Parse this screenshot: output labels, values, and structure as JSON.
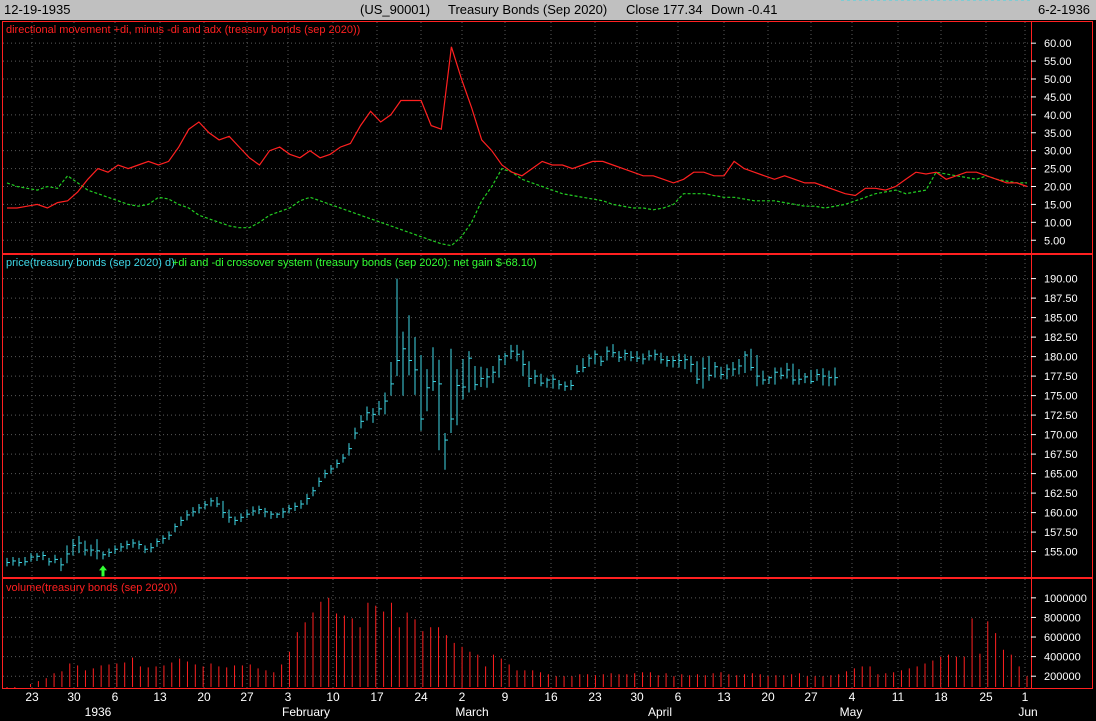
{
  "header": {
    "start_date": "12-19-1935",
    "symbol": "(US_90001)",
    "name": "Treasury Bonds (Sep 2020)",
    "close": "Close 177.34",
    "change": "Down -0.41",
    "end_date": "6-2-1936"
  },
  "colors": {
    "pos_di": "#ff2020",
    "neg_di": "#22cc22",
    "price": "#3fd7e6",
    "volume": "#ff2020",
    "up_arrow": "#33ff33",
    "down_arrow": "#ff2020",
    "grid": "#5a5a5a",
    "axis": "#ffffff",
    "border": "#ff2020"
  },
  "chart_data": [
    {
      "type": "line",
      "title": "directional movement +di, minus -di and adx (treasury bonds (sep 2020))",
      "ylim": [
        2,
        62
      ],
      "yticks": [
        "60.00",
        "55.00",
        "50.00",
        "45.00",
        "40.00",
        "35.00",
        "30.00",
        "25.00",
        "20.00",
        "15.00",
        "10.00",
        "5.00"
      ],
      "series": [
        {
          "name": "+di",
          "values": [
            14,
            14,
            14.5,
            15,
            14,
            15.5,
            16,
            18.5,
            22,
            25,
            24,
            26,
            25,
            26,
            27,
            26,
            27,
            31,
            36,
            38,
            35,
            33,
            34,
            31,
            28,
            26,
            30,
            31,
            29,
            28,
            30,
            28,
            29,
            31,
            32,
            37,
            41,
            38,
            40,
            44,
            44,
            44,
            37,
            36,
            59,
            50,
            42,
            33,
            30,
            26,
            24,
            23,
            25,
            27,
            26,
            26,
            25,
            26,
            27,
            27,
            26,
            25,
            24,
            23,
            23,
            22,
            21,
            22,
            24,
            24,
            23,
            23,
            27,
            25,
            24,
            23,
            22,
            23,
            22,
            21,
            21,
            20,
            19,
            18,
            17.5,
            19.5,
            19.5,
            19,
            20,
            22,
            24,
            23.5,
            24,
            22,
            23,
            24,
            24,
            23,
            22,
            21,
            21,
            20
          ]
        },
        {
          "name": "-di",
          "values": [
            21,
            20,
            19.5,
            19,
            20,
            19.5,
            23,
            21,
            19,
            18,
            17,
            16,
            15,
            14.5,
            15,
            17,
            16.5,
            15,
            14,
            12,
            11,
            10,
            9,
            8.5,
            8.5,
            10,
            12,
            13,
            14,
            16,
            17,
            16,
            15,
            14,
            13,
            12,
            11,
            10,
            9,
            8,
            7,
            6,
            5,
            4,
            3.5,
            6,
            10,
            16,
            20,
            25,
            24,
            22,
            21,
            20,
            19,
            18,
            17.5,
            17,
            16.5,
            16,
            15,
            14.5,
            14,
            14,
            13.5,
            14,
            15,
            18,
            18,
            18,
            17.5,
            17,
            17,
            16.5,
            16,
            16,
            16,
            15.5,
            15,
            14.5,
            14.5,
            14,
            14.5,
            15,
            16,
            17,
            18,
            18.5,
            19,
            18,
            18.5,
            19,
            24,
            23.5,
            23,
            22.5,
            22,
            23,
            22,
            21.5,
            21,
            21
          ]
        }
      ]
    },
    {
      "type": "bar",
      "title": "price(treasury bonds (sep 2020) d)",
      "subtitle": "+di and -di crossover system (treasury bonds (sep 2020): net gain $-68.10)",
      "ylim": [
        152,
        192
      ],
      "yticks": [
        "190.00",
        "187.50",
        "185.00",
        "182.50",
        "180.00",
        "177.50",
        "175.00",
        "172.50",
        "170.00",
        "167.50",
        "165.00",
        "162.50",
        "160.00",
        "157.50",
        "155.00"
      ],
      "x": [
        7,
        13,
        19,
        25,
        31,
        37,
        43,
        49,
        55,
        61,
        67,
        73,
        79,
        85,
        91,
        97,
        103,
        109,
        115,
        121,
        127,
        133,
        139,
        145,
        151,
        157,
        163,
        169,
        175,
        181,
        187,
        193,
        199,
        205,
        211,
        217,
        223,
        229,
        235,
        241,
        247,
        253,
        259,
        265,
        271,
        277,
        283,
        289,
        295,
        301,
        307,
        313,
        319,
        325,
        331,
        337,
        343,
        349,
        355,
        361,
        367,
        373,
        379,
        385,
        391,
        397,
        403,
        409,
        415,
        421,
        427,
        433,
        439,
        445,
        451,
        457,
        463,
        469,
        475,
        481,
        487,
        493,
        499,
        505,
        511,
        517,
        523,
        529,
        535,
        541,
        547,
        553,
        559,
        565,
        571,
        577,
        583,
        589,
        595,
        601,
        607,
        613,
        619,
        625,
        631,
        637,
        643,
        649,
        655,
        661,
        667,
        673,
        679,
        685,
        691,
        697,
        703,
        709,
        715,
        721,
        727,
        733,
        739,
        745,
        751,
        757,
        763,
        769,
        775,
        781,
        787,
        793,
        799,
        805,
        811,
        817,
        823,
        829,
        835,
        841,
        847,
        853,
        859,
        865,
        871,
        877,
        883,
        889,
        895,
        901,
        907,
        913,
        919,
        925,
        931,
        937,
        943,
        949,
        955,
        961,
        967,
        973,
        979,
        985,
        991,
        997,
        1003,
        1009,
        1015,
        1021,
        1027
      ],
      "high": [
        154.2,
        154.3,
        154.2,
        154.3,
        154.8,
        154.8,
        155,
        154.2,
        154.6,
        154.2,
        155.8,
        156.6,
        157,
        156.4,
        155.9,
        156.6,
        155,
        155.4,
        155.8,
        156.1,
        156.4,
        156.6,
        156.4,
        155.8,
        156.1,
        156.7,
        157.1,
        157.6,
        158.6,
        159.5,
        160.3,
        160.7,
        161.1,
        161.5,
        161.9,
        162,
        161.5,
        160.4,
        159.5,
        159.9,
        160.4,
        160.8,
        160.9,
        160.6,
        160.2,
        160,
        160.6,
        161,
        161.3,
        161.6,
        162.4,
        163.3,
        164.5,
        165.5,
        166.1,
        166.8,
        167.5,
        168.9,
        170.9,
        172.5,
        173.6,
        173.4,
        174.3,
        175.4,
        179.3,
        190,
        183.2,
        185.3,
        182.5,
        180.2,
        178.4,
        181.2,
        179.6,
        170.2,
        181,
        178.4,
        179.7,
        180.7,
        178.8,
        178.7,
        178.5,
        178.8,
        180.2,
        180.5,
        181.5,
        181.5,
        180.8,
        179.4,
        178.3,
        177.8,
        177.3,
        177.7,
        177,
        176.8,
        177,
        178.9,
        179.8,
        180.3,
        180.8,
        180.1,
        181.3,
        181.6,
        180.7,
        180.9,
        180.7,
        180.7,
        180.4,
        180.8,
        180.9,
        180.5,
        180.1,
        180.1,
        180.4,
        180.3,
        180.1,
        179.4,
        179.9,
        180.1,
        179.3,
        178.7,
        179,
        179.3,
        179.7,
        180.7,
        181,
        180.2,
        178.2,
        177.5,
        178.6,
        178.6,
        179.2,
        179.1,
        178.4,
        177.9,
        178.3,
        178.4,
        178.5,
        178.2,
        178.6
      ],
      "low": [
        153.1,
        153.2,
        153.1,
        153.2,
        153.7,
        153.8,
        153.9,
        153.2,
        153.5,
        152.5,
        153.5,
        154.5,
        154.8,
        154.5,
        154.4,
        154,
        154,
        154.3,
        154.7,
        155,
        155.3,
        155.5,
        155.3,
        154.8,
        154.9,
        155.6,
        156,
        156.5,
        157.5,
        158.3,
        159,
        159.5,
        159.9,
        160.4,
        160.8,
        160.7,
        159.3,
        158.7,
        158.4,
        158.8,
        159.3,
        159.6,
        159.8,
        159.4,
        159.2,
        159.3,
        159.3,
        159.9,
        160.2,
        160.5,
        161,
        162.1,
        163.3,
        164.4,
        165,
        165.7,
        166.4,
        167.3,
        169.4,
        170.8,
        171.8,
        171.5,
        172.5,
        172.6,
        175,
        177.5,
        175,
        177.6,
        175.1,
        170.5,
        173,
        175.6,
        168,
        165.5,
        170.2,
        171.2,
        174.5,
        175.4,
        175.7,
        176.1,
        176,
        176.6,
        177.3,
        178.9,
        179.7,
        179.4,
        177.5,
        176.1,
        176.5,
        176.2,
        176,
        175.9,
        175.8,
        175.6,
        175.7,
        177.8,
        178,
        178.7,
        179,
        178.8,
        179.5,
        179.9,
        179.3,
        179.5,
        179.4,
        179.3,
        179,
        179.5,
        179.5,
        179.1,
        178.7,
        178.6,
        178.6,
        178.4,
        178,
        176.5,
        175.9,
        176.9,
        177.3,
        177.1,
        177.1,
        177.5,
        177.7,
        177.9,
        178.2,
        176.2,
        176.4,
        176.5,
        176.4,
        177.1,
        177.2,
        176.4,
        176.4,
        176.6,
        176.5,
        176.9,
        176.3,
        176.2,
        176.3
      ],
      "close": [
        153.6,
        153.8,
        153.6,
        153.7,
        154.3,
        154.4,
        154.5,
        153.7,
        154,
        153.3,
        154.7,
        155.8,
        156.1,
        155.2,
        155.2,
        155.1,
        154.6,
        154.9,
        155.3,
        155.6,
        155.9,
        156.1,
        155.9,
        155.3,
        155.5,
        156.3,
        156.7,
        157.1,
        158.2,
        159,
        159.7,
        160.1,
        160.6,
        161,
        161.5,
        161.1,
        160,
        159.4,
        159,
        159.4,
        159.8,
        160.2,
        160.4,
        160.1,
        159.8,
        159.8,
        160.1,
        160.5,
        160.8,
        161.1,
        161.8,
        162.8,
        164,
        165,
        165.6,
        166.3,
        167,
        168.2,
        170.2,
        171.7,
        172.8,
        172.6,
        173.3,
        174.3,
        176.5,
        179.5,
        181,
        179.5,
        178.3,
        172,
        176,
        176.8,
        176.5,
        169.3,
        172,
        176.3,
        176.1,
        179.8,
        176.4,
        177.2,
        177.4,
        178,
        179.6,
        180.1,
        180.7,
        180.3,
        179,
        177.2,
        177.5,
        176.6,
        177,
        177.1,
        176.4,
        176.2,
        176.3,
        178.1,
        178.6,
        179.8,
        180.3,
        179.4,
        180.7,
        180.5,
        179.9,
        180.4,
        179.9,
        179.8,
        179.7,
        180.1,
        180.3,
        179.6,
        179.5,
        179.5,
        179.5,
        179.6,
        179,
        177.1,
        178.5,
        177.6,
        178.7,
        177.7,
        178.4,
        178.4,
        178.8,
        180.2,
        178.6,
        177.5,
        177,
        177.3,
        178,
        177.6,
        178.3,
        177,
        177.1,
        177.4,
        176.8,
        177.7,
        177.5,
        177.3,
        177.3
      ],
      "buy_arrows_x": [
        103,
        875,
        908,
        962,
        1022
      ],
      "sell_arrows_x": [
        866,
        892,
        935,
        996
      ]
    },
    {
      "type": "bar",
      "title": "volume(treasury bonds (sep 2020))",
      "ylim": [
        100000,
        1080000
      ],
      "yticks": [
        "1000000",
        "800000",
        "600000",
        "400000",
        "200000"
      ],
      "values": [
        80000,
        70000,
        90000,
        120000,
        150000,
        180000,
        230000,
        250000,
        330000,
        310000,
        260000,
        280000,
        310000,
        320000,
        330000,
        340000,
        390000,
        300000,
        290000,
        300000,
        310000,
        340000,
        380000,
        350000,
        320000,
        300000,
        330000,
        300000,
        290000,
        310000,
        310000,
        320000,
        280000,
        260000,
        240000,
        320000,
        450000,
        650000,
        750000,
        850000,
        960000,
        1000000,
        840000,
        820000,
        790000,
        700000,
        950000,
        920000,
        860000,
        950000,
        700000,
        850000,
        780000,
        660000,
        700000,
        700000,
        620000,
        540000,
        500000,
        450000,
        420000,
        300000,
        420000,
        380000,
        320000,
        260000,
        260000,
        260000,
        240000,
        220000,
        200000,
        200000,
        200000,
        220000,
        220000,
        210000,
        220000,
        230000,
        220000,
        220000,
        230000,
        240000,
        240000,
        210000,
        230000,
        200000,
        220000,
        210000,
        220000,
        210000,
        230000,
        240000,
        220000,
        210000,
        220000,
        230000,
        220000,
        200000,
        210000,
        210000,
        220000,
        230000,
        200000,
        200000,
        200000,
        210000,
        220000,
        250000,
        280000,
        300000,
        300000,
        220000,
        230000,
        240000,
        260000,
        280000,
        300000,
        330000,
        360000,
        400000,
        420000,
        400000,
        400000,
        790000,
        430000,
        760000,
        640000,
        470000,
        420000,
        300000,
        200000
      ]
    }
  ],
  "x_axis": {
    "day_labels": [
      {
        "text": "23",
        "x": 32
      },
      {
        "text": "30",
        "x": 74
      },
      {
        "text": "6",
        "x": 115
      },
      {
        "text": "13",
        "x": 160
      },
      {
        "text": "20",
        "x": 204
      },
      {
        "text": "27",
        "x": 247
      },
      {
        "text": "3",
        "x": 288
      },
      {
        "text": "10",
        "x": 333
      },
      {
        "text": "17",
        "x": 377
      },
      {
        "text": "24",
        "x": 421
      },
      {
        "text": "2",
        "x": 462
      },
      {
        "text": "9",
        "x": 505
      },
      {
        "text": "16",
        "x": 551
      },
      {
        "text": "23",
        "x": 595
      },
      {
        "text": "30",
        "x": 637
      },
      {
        "text": "6",
        "x": 678
      },
      {
        "text": "13",
        "x": 724
      },
      {
        "text": "20",
        "x": 768
      },
      {
        "text": "27",
        "x": 811
      },
      {
        "text": "4",
        "x": 852
      },
      {
        "text": "11",
        "x": 898
      },
      {
        "text": "18",
        "x": 941
      },
      {
        "text": "25",
        "x": 986
      },
      {
        "text": "1",
        "x": 1025
      }
    ],
    "month_labels": [
      {
        "text": "1936",
        "x": 98
      },
      {
        "text": "February",
        "x": 306
      },
      {
        "text": "March",
        "x": 472
      },
      {
        "text": "April",
        "x": 660
      },
      {
        "text": "May",
        "x": 851
      },
      {
        "text": "Jun",
        "x": 1028
      }
    ]
  }
}
